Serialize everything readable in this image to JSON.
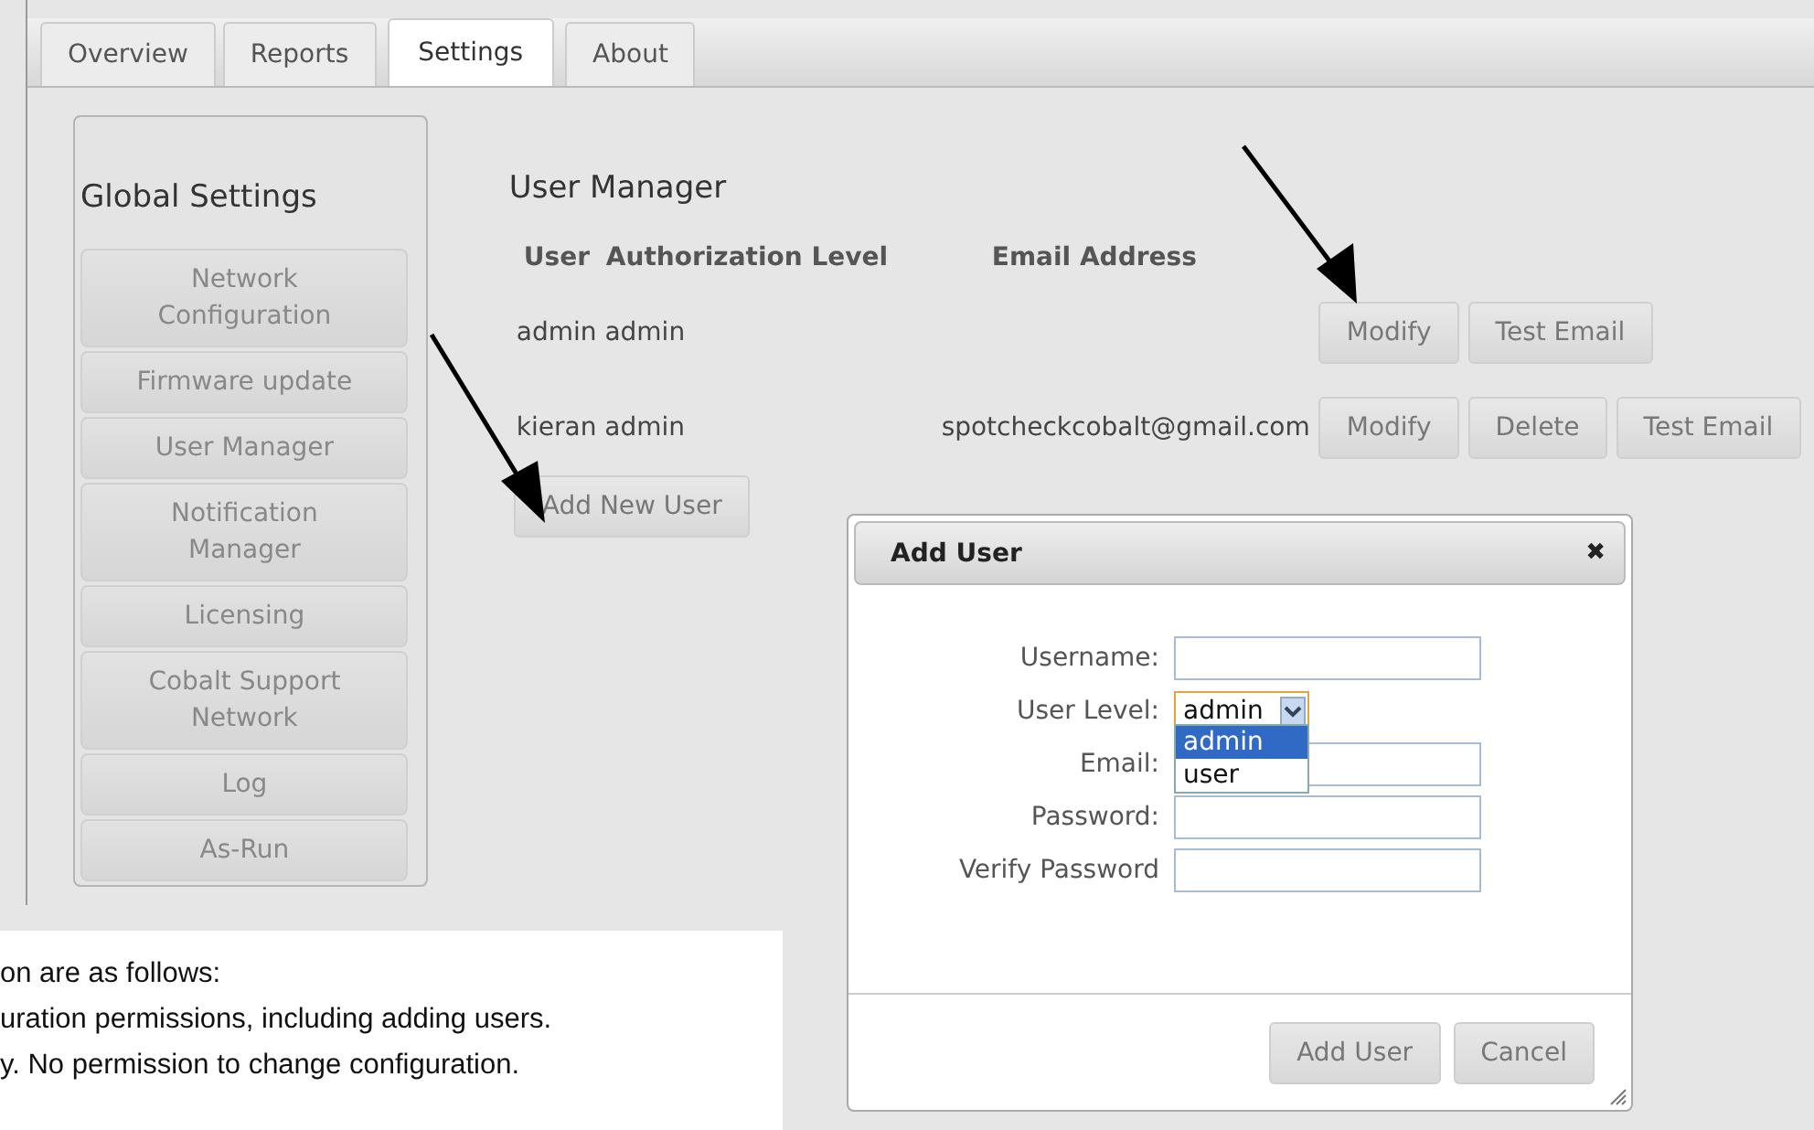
{
  "tabs": [
    {
      "label": "Overview",
      "selected": false
    },
    {
      "label": "Reports",
      "selected": false
    },
    {
      "label": "Settings",
      "selected": true
    },
    {
      "label": "About",
      "selected": false
    }
  ],
  "sidebar": {
    "title": "Global Settings",
    "items": [
      "Network Configuration",
      "Firmware update",
      "User Manager",
      "Notification Manager",
      "Licensing",
      "Cobalt Support Network",
      "Log",
      "As-Run"
    ]
  },
  "user_manager": {
    "title": "User Manager",
    "columns": [
      "User",
      "Authorization Level",
      "Email Address"
    ],
    "rows": [
      {
        "name": "admin admin",
        "buttons": [
          "Modify",
          "Test Email"
        ]
      },
      {
        "name": "kieran admin",
        "email": "spotcheckcobalt@gmail.com",
        "buttons": [
          "Modify",
          "Delete",
          "Test Email"
        ]
      }
    ],
    "add_button": "Add New User"
  },
  "dialog": {
    "title": "Add User",
    "close": "✖",
    "fields": [
      {
        "label": "Username:",
        "kind": "text"
      },
      {
        "label": "User Level:",
        "kind": "select",
        "value": "admin",
        "options": [
          {
            "label": "admin",
            "selected": true
          },
          {
            "label": "user",
            "selected": false
          }
        ]
      },
      {
        "label": "Email:",
        "kind": "text"
      },
      {
        "label": "Password:",
        "kind": "text"
      },
      {
        "label": "Verify Password",
        "kind": "text"
      }
    ],
    "buttons": [
      "Add User",
      "Cancel"
    ]
  },
  "doc_text": [
    "on are as follows:",
    "uration permissions, including adding users.",
    "y. No permission to change configuration."
  ]
}
